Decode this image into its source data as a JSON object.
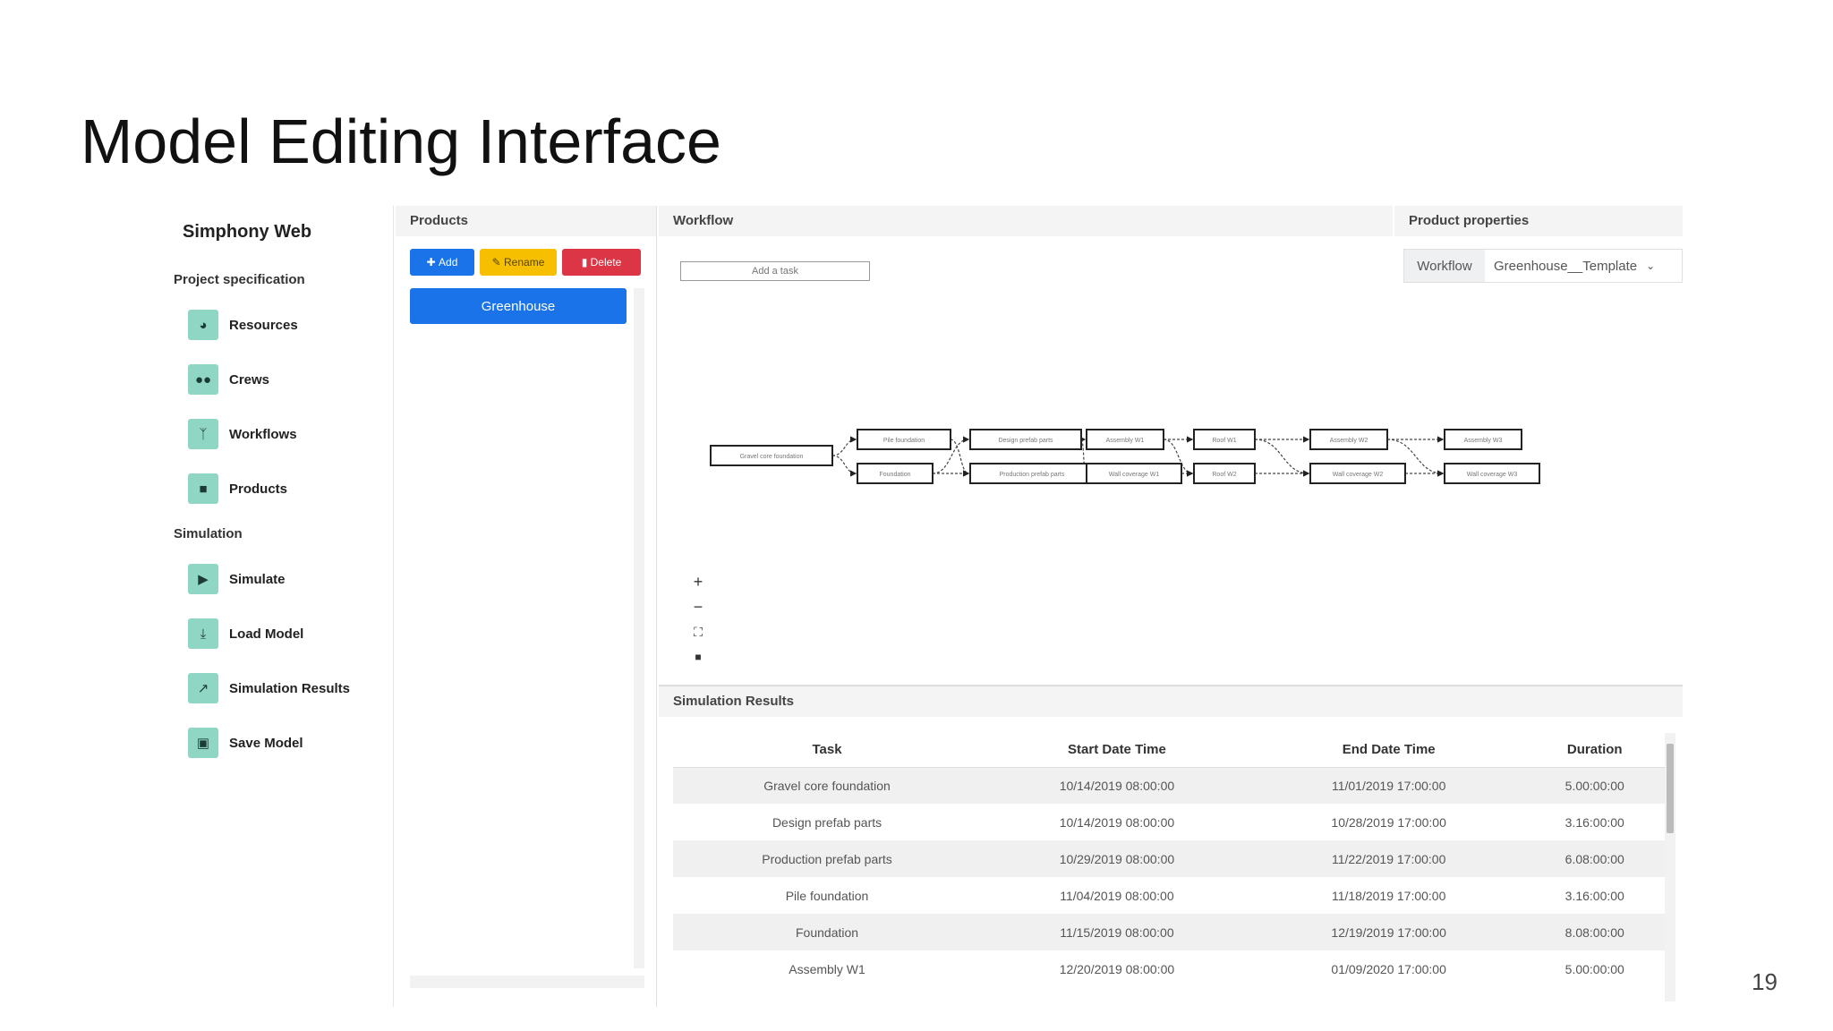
{
  "slide": {
    "title": "Model Editing Interface",
    "page_number": "19"
  },
  "sidebar": {
    "app_name": "Simphony Web",
    "sections": [
      {
        "title": "Project specification",
        "items": [
          {
            "label": "Resources",
            "icon": "gauge-icon"
          },
          {
            "label": "Crews",
            "icon": "users-icon"
          },
          {
            "label": "Workflows",
            "icon": "workflow-icon"
          },
          {
            "label": "Products",
            "icon": "box-icon"
          }
        ]
      },
      {
        "title": "Simulation",
        "items": [
          {
            "label": "Simulate",
            "icon": "play-icon"
          },
          {
            "label": "Load Model",
            "icon": "download-icon"
          },
          {
            "label": "Simulation Results",
            "icon": "chart-icon"
          },
          {
            "label": "Save Model",
            "icon": "save-icon"
          }
        ]
      }
    ]
  },
  "products": {
    "header": "Products",
    "add_label": "Add",
    "rename_label": "Rename",
    "delete_label": "Delete",
    "items": [
      "Greenhouse"
    ]
  },
  "workflow": {
    "header": "Workflow",
    "add_task_placeholder": "Add a task",
    "nodes": [
      "Gravel core foundation",
      "Pile foundation",
      "Foundation",
      "Design prefab parts",
      "Production prefab parts",
      "Assembly W1",
      "Wall coverage W1",
      "Roof W1",
      "Roof W2",
      "Assembly W2",
      "Wall coverage W2",
      "Assembly W3",
      "Wall coverage W3"
    ]
  },
  "properties": {
    "header": "Product properties",
    "select_label": "Workflow",
    "select_value": "Greenhouse__Template"
  },
  "results": {
    "header": "Simulation Results",
    "columns": [
      "Task",
      "Start Date Time",
      "End Date Time",
      "Duration"
    ],
    "rows": [
      [
        "Gravel core foundation",
        "10/14/2019 08:00:00",
        "11/01/2019 17:00:00",
        "5.00:00:00"
      ],
      [
        "Design prefab parts",
        "10/14/2019 08:00:00",
        "10/28/2019 17:00:00",
        "3.16:00:00"
      ],
      [
        "Production prefab parts",
        "10/29/2019 08:00:00",
        "11/22/2019 17:00:00",
        "6.08:00:00"
      ],
      [
        "Pile foundation",
        "11/04/2019 08:00:00",
        "11/18/2019 17:00:00",
        "3.16:00:00"
      ],
      [
        "Foundation",
        "11/15/2019 08:00:00",
        "12/19/2019 17:00:00",
        "8.08:00:00"
      ],
      [
        "Assembly W1",
        "12/20/2019 08:00:00",
        "01/09/2020 17:00:00",
        "5.00:00:00"
      ]
    ]
  }
}
